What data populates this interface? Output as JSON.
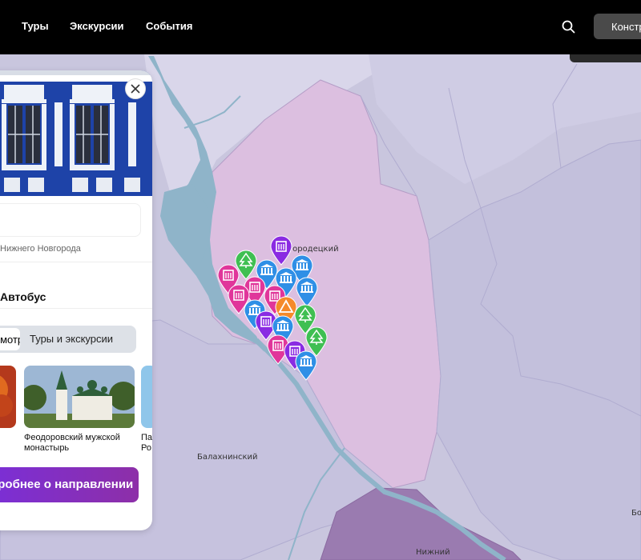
{
  "header": {
    "nav": [
      "Туры",
      "Экскурсии",
      "События"
    ],
    "construct_label": "Конструктор"
  },
  "map": {
    "labels": [
      "Городецкий",
      "Балахнинский",
      "Нижний",
      "Бо"
    ]
  },
  "panel": {
    "subtitle": "Нижнего Новгорода",
    "transport": "Автобус",
    "tabs": [
      "Посмотреть",
      "Туры и экскурсии"
    ],
    "cards": [
      {
        "title": ""
      },
      {
        "title_line1": "Феодоровский мужской",
        "title_line2": "монастырь"
      },
      {
        "title_line1": "Па",
        "title_line2": "Ро"
      }
    ],
    "more_button": "Подробнее о направлении"
  },
  "colors": {
    "pin_pink": "#e0369a",
    "pin_purple": "#8a2be2",
    "pin_blue": "#2f8fe6",
    "pin_green": "#3fbf52",
    "pin_orange": "#f58a2a"
  },
  "pins": [
    {
      "icon": "building-icon",
      "color": "pin_purple"
    },
    {
      "icon": "tree-icon",
      "color": "pin_green"
    },
    {
      "icon": "building-icon",
      "color": "pin_pink"
    },
    {
      "icon": "museum-icon",
      "color": "pin_blue"
    },
    {
      "icon": "museum-icon",
      "color": "pin_blue"
    },
    {
      "icon": "building-icon",
      "color": "pin_pink"
    },
    {
      "icon": "building-icon",
      "color": "pin_pink"
    },
    {
      "icon": "museum-icon",
      "color": "pin_blue"
    },
    {
      "icon": "museum-icon",
      "color": "pin_blue"
    },
    {
      "icon": "building-icon",
      "color": "pin_pink"
    },
    {
      "icon": "museum-icon",
      "color": "pin_blue"
    },
    {
      "icon": "tent-icon",
      "color": "pin_orange"
    },
    {
      "icon": "tree-icon",
      "color": "pin_green"
    },
    {
      "icon": "building-icon",
      "color": "pin_purple"
    },
    {
      "icon": "museum-icon",
      "color": "pin_blue"
    },
    {
      "icon": "tree-icon",
      "color": "pin_green"
    },
    {
      "icon": "building-icon",
      "color": "pin_pink"
    },
    {
      "icon": "building-icon",
      "color": "pin_purple"
    },
    {
      "icon": "museum-icon",
      "color": "pin_blue"
    }
  ]
}
